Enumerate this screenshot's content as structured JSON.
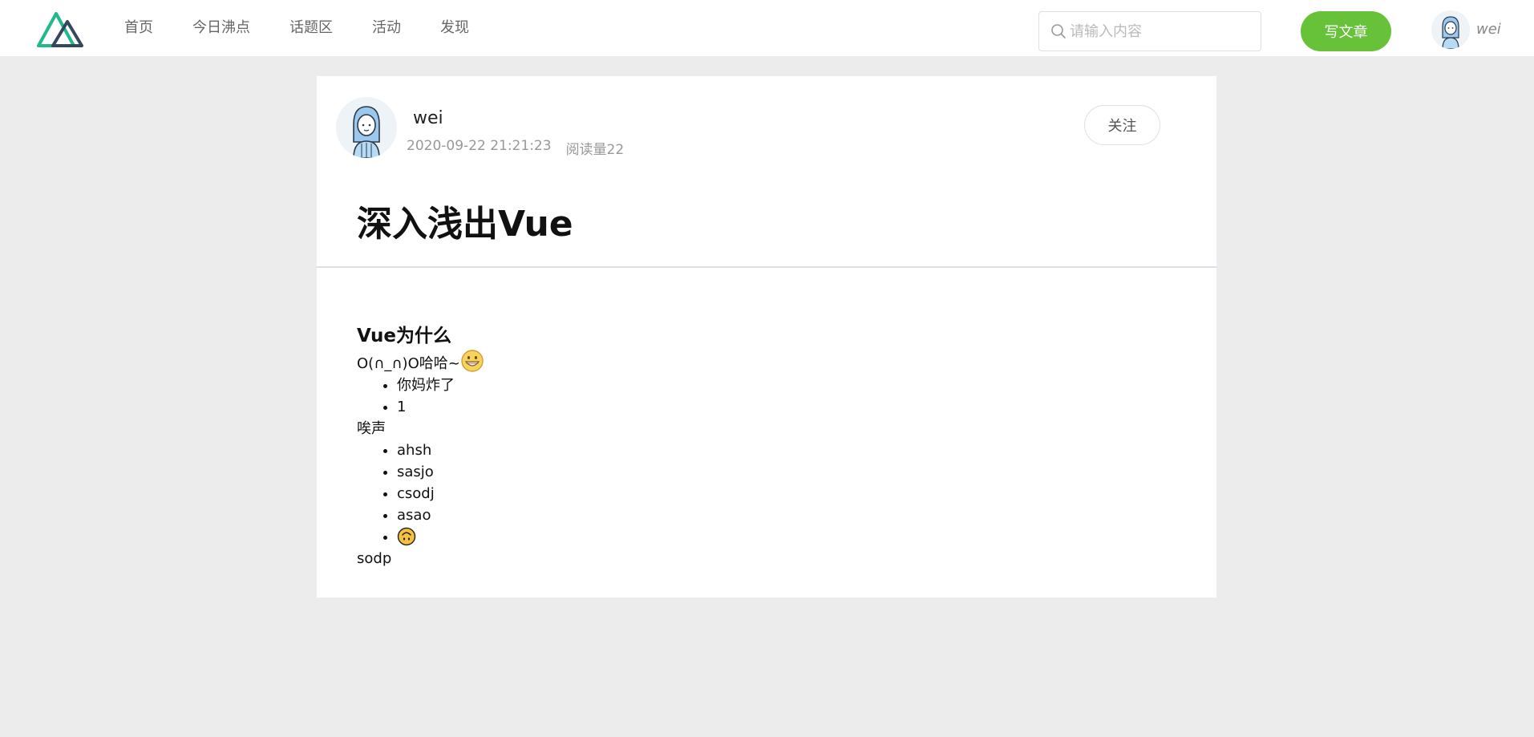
{
  "nav": {
    "items": [
      {
        "label": "首页"
      },
      {
        "label": "今日沸点"
      },
      {
        "label": "话题区"
      },
      {
        "label": "活动"
      },
      {
        "label": "发现"
      }
    ],
    "search_placeholder": "请输入内容",
    "write_label": "写文章",
    "username": "wei",
    "logo_icon": "mountain-logo-icon"
  },
  "article": {
    "author": "wei",
    "date": "2020-09-22 21:21:23",
    "views": "阅读量22",
    "follow_label": "关注",
    "title": "深入浅出Vue",
    "heading": "Vue为什么",
    "line1": "O(∩_∩)O哈哈~",
    "list1": [
      "你妈炸了",
      "1"
    ],
    "line2": "唉声",
    "list2": [
      "ahsh",
      "sasjo",
      "csodj",
      "asao"
    ],
    "line3": "sodp",
    "emoji1": "grinning-face-emoji",
    "emoji2": "upside-down-face-emoji"
  },
  "colors": {
    "accent": "#67c23a",
    "background": "#ececec",
    "logo_green": "#1fb98a",
    "logo_dark": "#35495e"
  }
}
